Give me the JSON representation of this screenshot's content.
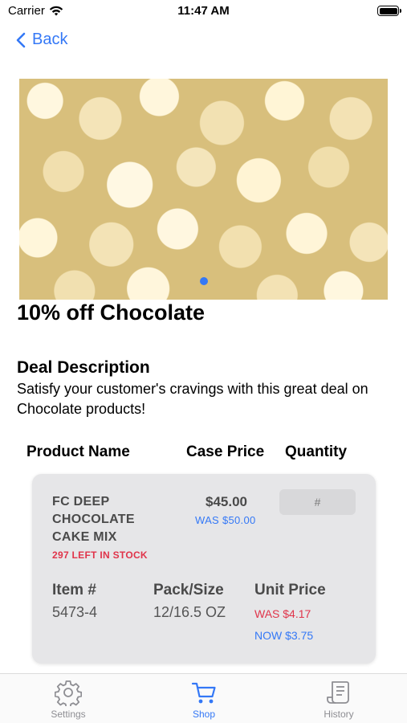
{
  "status_bar": {
    "carrier": "Carrier",
    "time": "11:47 AM"
  },
  "nav": {
    "back_label": "Back"
  },
  "deal": {
    "title": "10% off Chocolate",
    "description_heading": "Deal Description",
    "description": "Satisfy your customer's cravings with this great deal on Chocolate products!"
  },
  "table_headers": {
    "product_name": "Product Name",
    "case_price": "Case Price",
    "quantity": "Quantity"
  },
  "product": {
    "name": "FC DEEP CHOCOLATE CAKE MIX",
    "stock": "297 LEFT IN STOCK",
    "case_price": "$45.00",
    "was_price": "WAS $50.00",
    "quantity_placeholder": "#",
    "item_label": "Item #",
    "item_value": "5473-4",
    "pack_label": "Pack/Size",
    "pack_value": "12/16.5 OZ",
    "unit_label": "Unit Price",
    "unit_was": "WAS $4.17",
    "unit_now": "NOW $3.75"
  },
  "tabs": [
    {
      "label": "Settings",
      "icon": "gear-icon",
      "active": false
    },
    {
      "label": "Shop",
      "icon": "cart-icon",
      "active": true
    },
    {
      "label": "History",
      "icon": "receipt-icon",
      "active": false
    }
  ],
  "colors": {
    "accent": "#3478f6",
    "alert": "#e0344a",
    "inactive": "#8e8e93"
  }
}
